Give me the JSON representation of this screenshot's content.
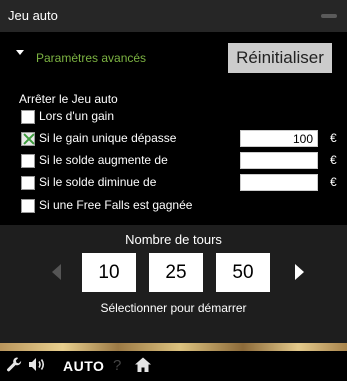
{
  "window": {
    "title": "Jeu auto"
  },
  "advanced": {
    "label": "Paramètres avancés",
    "reset_label": "Réinitialiser"
  },
  "stop": {
    "title": "Arrêter le Jeu auto",
    "options": [
      {
        "label": "Lors d'un gain",
        "checked": false
      },
      {
        "label": "Si le gain unique dépasse",
        "checked": true,
        "value": "100",
        "currency": "€"
      },
      {
        "label": "Si le solde augmente de",
        "checked": false,
        "value": "",
        "currency": "€"
      },
      {
        "label": "Si le solde diminue de",
        "checked": false,
        "value": "",
        "currency": "€"
      },
      {
        "label": "Si une Free Falls est gagnée",
        "checked": false
      }
    ]
  },
  "rounds": {
    "label": "Nombre de tours",
    "options": [
      "10",
      "25",
      "50"
    ],
    "select_label": "Sélectionner pour démarrer"
  },
  "toolbar": {
    "auto_label": "AUTO",
    "icons": [
      "wrench-icon",
      "speaker-icon",
      "help-icon",
      "home-icon"
    ]
  },
  "colors": {
    "accent_green": "#7cb342",
    "background": "#000000",
    "rounds_bg": "#1e1e1e"
  }
}
